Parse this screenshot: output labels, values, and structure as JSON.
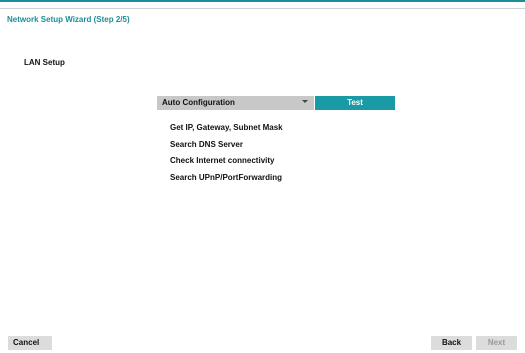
{
  "window": {
    "title": "Network Setup Wizard (Step 2/5)"
  },
  "section": {
    "label": "LAN Setup"
  },
  "config": {
    "mode_selected": "Auto Configuration",
    "test_label": "Test"
  },
  "steps": [
    "Get IP, Gateway, Subnet Mask",
    "Search DNS Server",
    "Check Internet connectivity",
    "Search UPnP/PortForwarding"
  ],
  "footer": {
    "cancel_label": "Cancel",
    "back_label": "Back",
    "next_label": "Next"
  },
  "colors": {
    "accent": "#1a9aa5",
    "select_bg": "#c8c8c8",
    "button_bg": "#dcdcdc",
    "disabled_text": "#9a9a9a"
  },
  "icons": {
    "dropdown": "chevron-down-icon"
  }
}
